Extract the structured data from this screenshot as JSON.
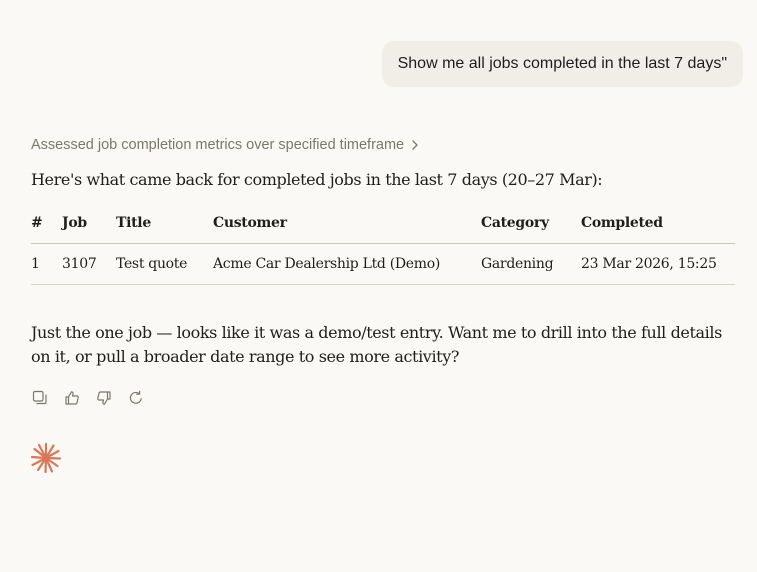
{
  "conversation": {
    "user_message": "Show me all jobs completed in the last 7 days\"",
    "thinking_summary": "Assessed job completion metrics over specified timeframe",
    "intro_text": "Here's what came back for completed jobs in the last 7 days (20–27 Mar):",
    "table": {
      "headers": [
        "#",
        "Job",
        "Title",
        "Customer",
        "Category",
        "Completed"
      ],
      "rows": [
        [
          "1",
          "3107",
          "Test quote",
          "Acme Car Dealership Ltd (Demo)",
          "Gardening",
          "23 Mar 2026, 15:25"
        ]
      ]
    },
    "answer_text": "Just the one job — looks like it was a demo/test entry. Want me to drill into the full details on it, or pull a broader date range to see more activity?"
  },
  "actions": {
    "icons": [
      "copy-icon",
      "thumbs-up-icon",
      "thumbs-down-icon",
      "retry-icon"
    ]
  },
  "colors": {
    "background": "#faf9f5",
    "bubble": "#f0eee6",
    "accent": "#d97757",
    "muted_text": "#7a776f"
  }
}
